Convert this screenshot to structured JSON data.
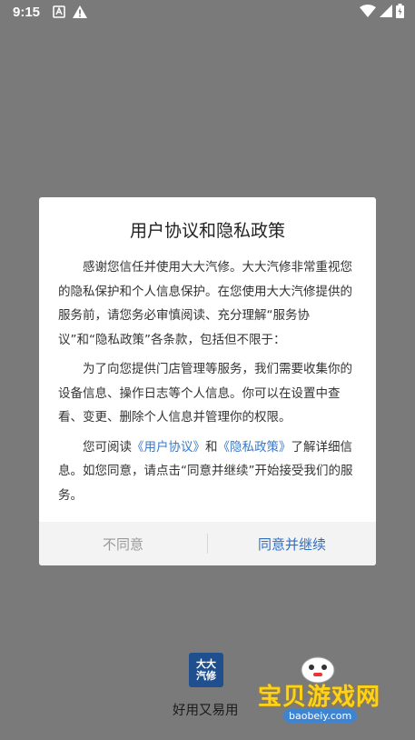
{
  "status_bar": {
    "time": "9:15"
  },
  "dialog": {
    "title": "用户协议和隐私政策",
    "para1": "感谢您信任并使用大大汽修。大大汽修非常重视您的隐私保护和个人信息保护。在您使用大大汽修提供的服务前，请您务必审慎阅读、充分理解“服务协议”和“隐私政策”各条款，包括但不限于：",
    "para2": "为了向您提供门店管理等服务，我们需要收集你的设备信息、操作日志等个人信息。你可以在设置中查看、变更、删除个人信息并管理你的权限。",
    "para3_prefix": "您可阅读",
    "link_user_agreement": "《用户协议》",
    "para3_and": "和",
    "link_privacy_policy": "《隐私政策》",
    "para3_suffix": "了解详细信息。如您同意，请点击“同意并继续”开始接受我们的服务。",
    "disagree_label": "不同意",
    "agree_label": "同意并继续"
  },
  "branding": {
    "logo_line1": "大大",
    "logo_line2": "汽修",
    "slogan": "好用又易用"
  },
  "watermark": {
    "name": "宝贝游戏网",
    "url": "baobeiy.com"
  },
  "colors": {
    "scrim": "#7a7a7a",
    "link": "#3a78c4",
    "agree": "#2f6fc1",
    "disagree": "#9a9a9a",
    "logo_bg": "#1f4f8f"
  }
}
